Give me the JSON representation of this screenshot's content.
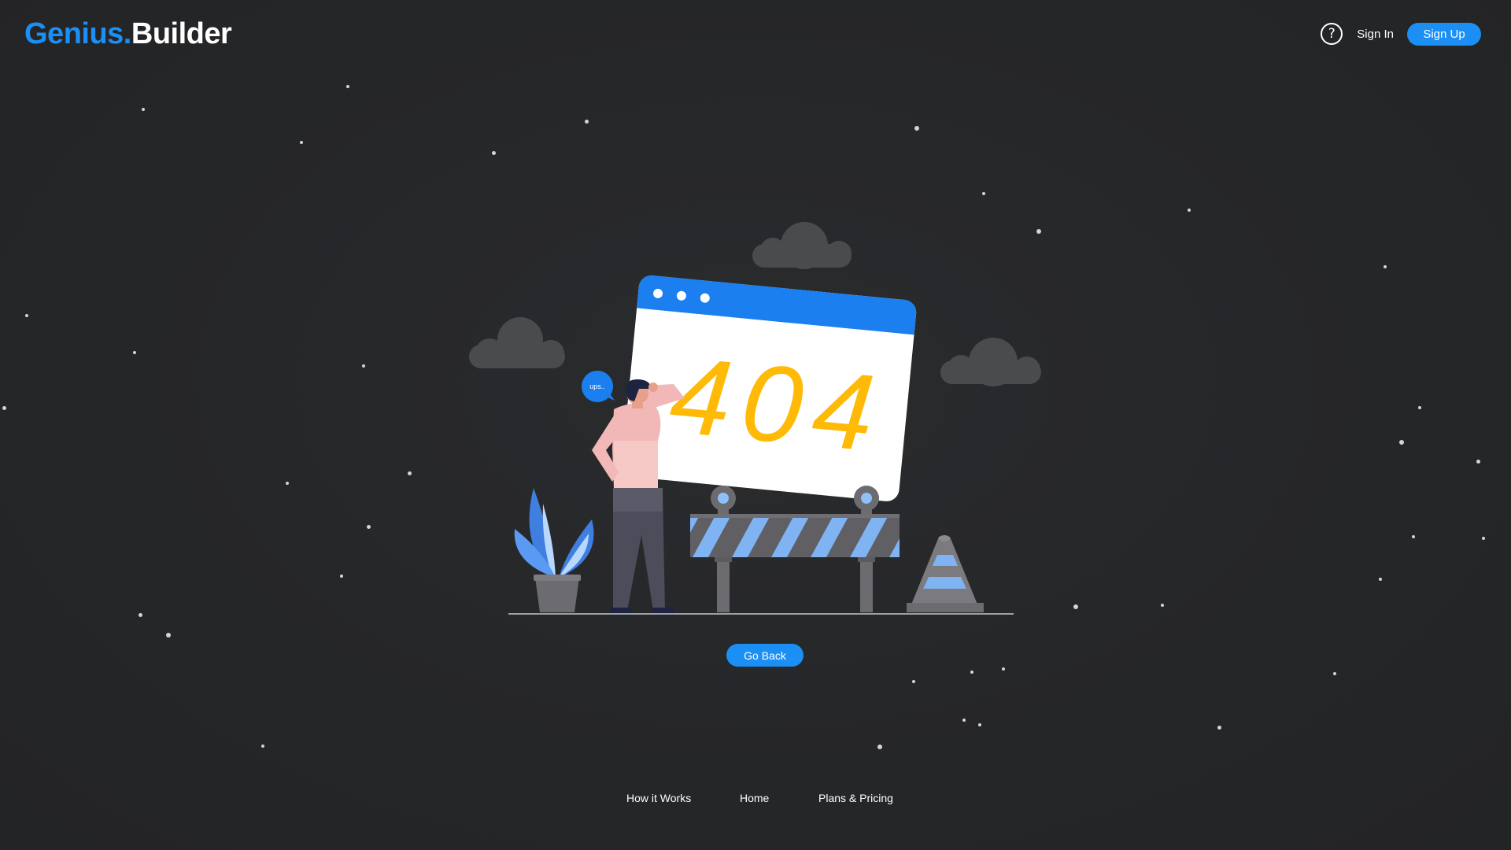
{
  "header": {
    "logo_part1": "Genius.",
    "logo_part2": "Builder",
    "help_icon": "question-circle-icon",
    "help_glyph": "?",
    "signin_label": "Sign In",
    "signup_label": "Sign Up"
  },
  "illustration": {
    "error_code": "404",
    "speech_bubble": "ups..",
    "icons": [
      "cloud-icon",
      "browser-window-icon",
      "person-icon",
      "plant-icon",
      "barrier-icon",
      "traffic-cone-icon"
    ]
  },
  "main": {
    "go_back_label": "Go Back"
  },
  "footer": {
    "links": [
      "How it Works",
      "Home",
      "Plans & Pricing"
    ]
  },
  "colors": {
    "background": "#262729",
    "accent": "#1c8ff5",
    "error_code": "#ffba08",
    "barrier_stripe": "#7fb3f2"
  }
}
